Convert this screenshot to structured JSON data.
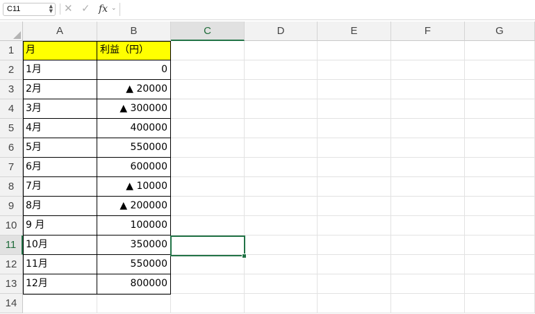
{
  "formula_bar": {
    "name_box": "C11",
    "formula": ""
  },
  "grid": {
    "columns": [
      "A",
      "B",
      "C",
      "D",
      "E",
      "F",
      "G"
    ],
    "selected_column": "C",
    "selected_row": "11",
    "rows": [
      {
        "num": "1",
        "a": "月",
        "b": "利益（円）"
      },
      {
        "num": "2",
        "a": "1月",
        "b": "0"
      },
      {
        "num": "3",
        "a": "2月",
        "b": "▲ 20000"
      },
      {
        "num": "4",
        "a": "3月",
        "b": "▲ 300000"
      },
      {
        "num": "5",
        "a": "4月",
        "b": "400000"
      },
      {
        "num": "6",
        "a": "5月",
        "b": "550000"
      },
      {
        "num": "7",
        "a": "6月",
        "b": "600000"
      },
      {
        "num": "8",
        "a": "7月",
        "b": "▲ 10000"
      },
      {
        "num": "9",
        "a": "8月",
        "b": "▲ 200000"
      },
      {
        "num": "10",
        "a": "9 月",
        "b": "100000"
      },
      {
        "num": "11",
        "a": "10月",
        "b": "350000"
      },
      {
        "num": "12",
        "a": "11月",
        "b": "550000"
      },
      {
        "num": "13",
        "a": "12月",
        "b": "800000"
      },
      {
        "num": "14",
        "a": "",
        "b": ""
      }
    ]
  },
  "colors": {
    "header_fill": "#ffff00",
    "selection": "#217346"
  }
}
